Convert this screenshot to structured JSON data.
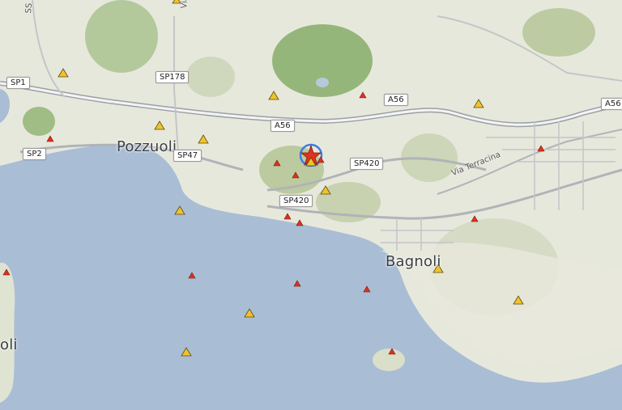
{
  "map": {
    "colors": {
      "sea": "#a9bdd5",
      "land": "#e7e8dc",
      "green": "#a6c08c",
      "road_major": "#9aa0a6",
      "road_minor": "#c3c6c8",
      "quake_red": "#e0301e",
      "station_yellow": "#f0c32a",
      "epicenter_ring": "#3f7fe0"
    },
    "places": {
      "pozzuoli": "Pozzuoli",
      "bagnoli": "Bagnoli",
      "ischia_fragment": "oli"
    },
    "roads": {
      "sp1": "SP1",
      "sp2": "SP2",
      "sp178": "SP178",
      "sp47": "SP47",
      "a56_left": "A56",
      "a56_mid": "A56",
      "a56_right": "A56",
      "sp420_top": "SP420",
      "sp420_bottom": "SP420"
    },
    "streets": {
      "via_terracina": "Via Terracina",
      "via_ca": "Via Ca",
      "left_edge": "SS"
    },
    "markers": {
      "epicenter_icon": "star-icon",
      "quake_icon": "red-triangle-icon",
      "station_icon": "yellow-triangle-icon"
    }
  }
}
